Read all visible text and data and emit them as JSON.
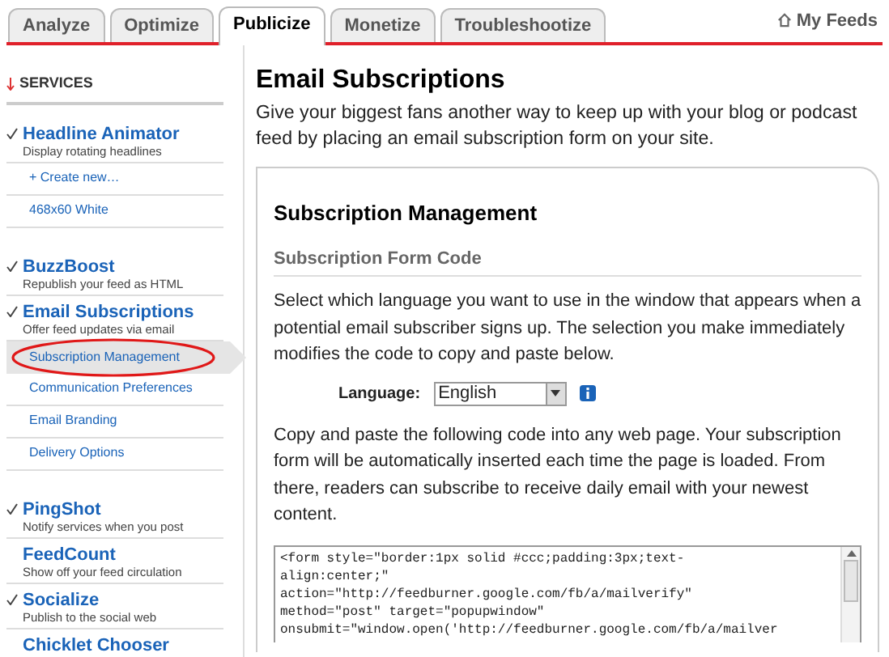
{
  "tabs": [
    {
      "label": "Analyze",
      "selected": false
    },
    {
      "label": "Optimize",
      "selected": false
    },
    {
      "label": "Publicize",
      "selected": true
    },
    {
      "label": "Monetize",
      "selected": false
    },
    {
      "label": "Troubleshootize",
      "selected": false
    }
  ],
  "my_feeds": "My Feeds",
  "sidebar": {
    "header": "SERVICES",
    "items": [
      {
        "kind": "service",
        "title": "Headline Animator",
        "subtitle": "Display rotating headlines",
        "checked": true
      },
      {
        "kind": "link",
        "label": "+ Create new…",
        "selected": false,
        "circled": false
      },
      {
        "kind": "link",
        "label": "468x60 White",
        "selected": false,
        "circled": false
      },
      {
        "kind": "gap"
      },
      {
        "kind": "service",
        "title": "BuzzBoost",
        "subtitle": "Republish your feed as HTML",
        "checked": true
      },
      {
        "kind": "service",
        "title": "Email Subscriptions",
        "subtitle": "Offer feed updates via email",
        "checked": true
      },
      {
        "kind": "link",
        "label": "Subscription Management",
        "selected": true,
        "circled": true
      },
      {
        "kind": "link",
        "label": "Communication Preferences",
        "selected": false,
        "circled": false
      },
      {
        "kind": "link",
        "label": "Email Branding",
        "selected": false,
        "circled": false
      },
      {
        "kind": "link",
        "label": "Delivery Options",
        "selected": false,
        "circled": false
      },
      {
        "kind": "gap"
      },
      {
        "kind": "service",
        "title": "PingShot",
        "subtitle": "Notify services when you post",
        "checked": true
      },
      {
        "kind": "service",
        "title": "FeedCount",
        "subtitle": "Show off your feed circulation",
        "checked": false
      },
      {
        "kind": "service",
        "title": "Socialize",
        "subtitle": "Publish to the social web",
        "checked": true
      },
      {
        "kind": "service",
        "title": "Chicklet Chooser",
        "checked": false
      }
    ]
  },
  "content": {
    "title": "Email Subscriptions",
    "intro": "Give your biggest fans another way to keep up with your blog or podcast feed by placing an email subscription form on your site.",
    "panel": {
      "title": "Subscription Management",
      "section_title": "Subscription Form Code",
      "description": "Select which language you want to use in the window that appears when a potential email subscriber signs up. The selection you make immediately modifies the code to copy and paste below.",
      "language_label": "Language:",
      "language_value": "English",
      "instructions": "Copy and paste the following code into any web page. Your subscription form will be automatically inserted each time the page is loaded. From there, readers can subscribe to receive daily email with your newest content.",
      "code_lines": [
        "<form style=\"border:1px solid #ccc;padding:3px;text-",
        "align:center;\"",
        "action=\"http://feedburner.google.com/fb/a/mailverify\"",
        "method=\"post\" target=\"popupwindow\"",
        "onsubmit=\"window.open('http://feedburner.google.com/fb/a/mailver"
      ]
    }
  }
}
